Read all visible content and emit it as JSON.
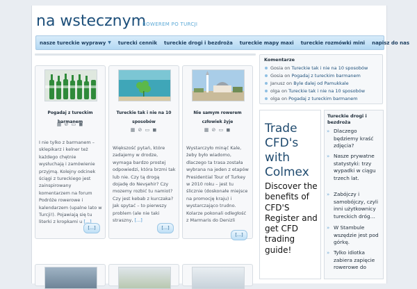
{
  "header": {
    "title": "na wstecznym",
    "tagline": "rowerem po Turcji"
  },
  "nav": [
    {
      "label": "nasze tureckie wyprawy",
      "dropdown": true
    },
    {
      "label": "turecki cennik"
    },
    {
      "label": "tureckie drogi i bezdroża"
    },
    {
      "label": "tureckie mapy maxi"
    },
    {
      "label": "tureckie rozmówki mini"
    },
    {
      "label": "napisz do nas"
    }
  ],
  "posts": [
    {
      "title": "Pogadaj z tureckim barmanem",
      "meta": "▦ ⊘ ▭ ◼",
      "excerpt": "I nie tylko z barmanem – sklepikarz i kelner też każdego chętnie wysłuchają i zamówienie przyjmą. Kolejny odcinek ściągi z tureckiego jest zainspirowany komentarzem na forum Podróże rowerowe i kalendarzem (upalne lato w Turcji!). Pojawiają się tu literki z kropkami u",
      "ellipsis": "[...]",
      "more": "[...]"
    },
    {
      "title": "Tureckie tak i nie na 10 sposobów",
      "meta": "▦ ⊘ ▭ ◼",
      "excerpt": "Większość pytań, które zadajemy w drodze, wymaga bardzo prostej odpowiedzi, która brzmi tak lub nie. Czy tą drogą dojadę do Nevşehir? Czy mozemy rozbić tu namiot? Czy jest kebab z kurczaka? Jak spytać – to pierwszy problem (ale nie taki straszny,",
      "ellipsis": "[...]",
      "more": "[...]"
    },
    {
      "title": "Nie samym rowerem człowiek żyje",
      "meta": "▦ ⊘ ▭ ◼",
      "excerpt": "Wystarczyło minąć Kale, żeby było wiadomo, dlaczego ta trasa została wybrana na jeden z etapów Presidential Tour of Turkey w 2010 roku – jest tu ślicznie (doskonałe miejsce na promocję kraju) i wystarczająco trudno. Kolarze pokonali odległość z Marmaris do Denizli",
      "ellipsis": "",
      "more": "[...]"
    }
  ],
  "comments": {
    "heading": "Komentarze",
    "on": "on",
    "items": [
      {
        "author": "Gosia",
        "post": "Tureckie tak i nie na 10 sposobów"
      },
      {
        "author": "Gosia",
        "post": "Pogadaj z tureckim barmanem"
      },
      {
        "author": "Janusz",
        "post": "Byle dalej od Pamukkale"
      },
      {
        "author": "olga",
        "post": "Tureckie tak i nie na 10 sposobów"
      },
      {
        "author": "olga",
        "post": "Pogadaj z tureckim barmanem"
      }
    ]
  },
  "ad": {
    "headline": "Trade CFD's with Colmex",
    "body": "Discover the benefits of CFD'S Register and get CFD trading guide!"
  },
  "sidebar": {
    "heading": "Tureckie drogi i bezdroża",
    "items": [
      "Dlaczego będziemy kraść zdjęcia?",
      "Nasze prywatne statystyki: trzy wypadki w ciągu trzech lat.",
      "Zabójczy i samobójczy, czyli inni użytkownicy tureckich dróg…",
      "W Stambule wszędzie jest pod górkę.",
      "Tylko idiotka zabiera zapięcie rowerowe do"
    ]
  },
  "colors": {
    "accent": "#1d4f7a",
    "link": "#3c8fcf",
    "nav": "#b3d8f3"
  }
}
